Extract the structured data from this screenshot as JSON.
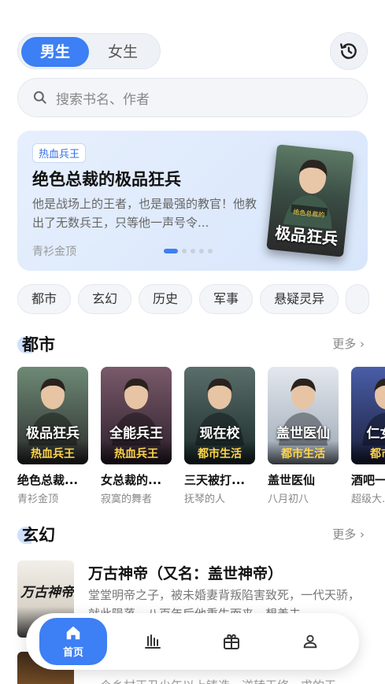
{
  "header": {
    "gender_tabs": [
      {
        "label": "男生",
        "active": true
      },
      {
        "label": "女生",
        "active": false
      }
    ],
    "history_icon": "history-icon"
  },
  "search": {
    "placeholder": "搜索书名、作者"
  },
  "banner": {
    "tag": "热血兵王",
    "title": "绝色总裁的极品狂兵",
    "description": "他是战场上的王者，也是最强的教官！他教出了无数兵王，只等他一声号令...",
    "author": "青衫金顶",
    "cover_text": "极品狂兵",
    "cover_subtext": "绝色总裁的",
    "carousel_count": 5,
    "carousel_active": 0
  },
  "categories": [
    "都市",
    "玄幻",
    "历史",
    "军事",
    "悬疑灵异"
  ],
  "section_dushi": {
    "title": "都市",
    "more": "更多",
    "books": [
      {
        "title": "绝色总裁...",
        "author": "青衫金顶",
        "badge": "热血兵王",
        "cover_text": "极品狂兵",
        "color1": "#6e8a76",
        "color2": "#2b2b2b"
      },
      {
        "title": "女总裁的...",
        "author": "寂寞的舞者",
        "badge": "热血兵王",
        "cover_text": "全能兵王",
        "color1": "#7a5a6a",
        "color2": "#2a1e2a"
      },
      {
        "title": "三天被打...",
        "author": "抚琴的人",
        "badge": "都市生活",
        "cover_text": "现在校",
        "color1": "#5a6e6a",
        "color2": "#1a2a2a"
      },
      {
        "title": "盖世医仙",
        "author": "八月初八",
        "badge": "都市生活",
        "cover_text": "盖世医仙",
        "color1": "#e4e8ee",
        "color2": "#9aa6b4"
      },
      {
        "title": "酒吧一...",
        "author": "超级大...",
        "badge": "都市生",
        "cover_text": "仁女神",
        "color1": "#4a5ea8",
        "color2": "#1a1f3a"
      }
    ]
  },
  "section_xuanhuan": {
    "title": "玄幻",
    "more": "更多",
    "items": [
      {
        "title": "万古神帝（又名：盖世神帝）",
        "description": "堂堂明帝之子，被未婚妻背叛陷害致死，一代天骄，就此陨落。八百年后他重生而来，想善夫...",
        "cover_text": "万古神帝"
      },
      {
        "title": "",
        "description": "一个乡村正丑少年以上铸造，逆转天修，求的天..."
      }
    ]
  },
  "bottom_nav": [
    {
      "label": "首页",
      "icon": "home-icon",
      "active": true
    },
    {
      "label": "",
      "icon": "ranking-icon",
      "active": false
    },
    {
      "label": "",
      "icon": "gift-icon",
      "active": false
    },
    {
      "label": "",
      "icon": "profile-icon",
      "active": false
    }
  ],
  "colors": {
    "accent": "#3d7ff4",
    "badge_text": "#ffd54a",
    "banner_bg": "#e6effd"
  }
}
